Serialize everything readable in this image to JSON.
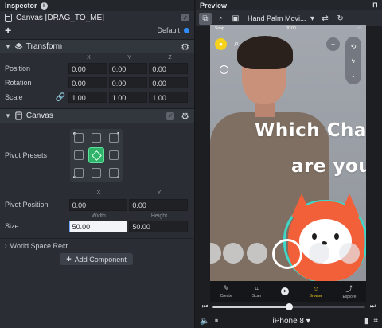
{
  "inspector": {
    "title": "Inspector",
    "info_icon": "i",
    "object_name": "Canvas [DRAG_TO_ME]",
    "object_enabled": "✓",
    "add_label": "+",
    "layer": "Default",
    "transform": {
      "title": "Transform",
      "axes": [
        "X",
        "Y",
        "Z"
      ],
      "position_label": "Position",
      "position": [
        "0.00",
        "0.00",
        "0.00"
      ],
      "rotation_label": "Rotation",
      "rotation": [
        "0.00",
        "0.00",
        "0.00"
      ],
      "scale_label": "Scale",
      "scale": [
        "1.00",
        "1.00",
        "1.00"
      ]
    },
    "canvas": {
      "title": "Canvas",
      "enabled": "✓",
      "pivot_presets_label": "Pivot Presets",
      "xy_labels": [
        "X",
        "Y"
      ],
      "pivot_position_label": "Pivot Position",
      "pivot_position": [
        "0.00",
        "0.00"
      ],
      "wh_labels": [
        "Width",
        "Height"
      ],
      "size_label": "Size",
      "size": [
        "50.00",
        "50.00"
      ],
      "world_space_label": "World Space Rect"
    },
    "add_component": "Add Component"
  },
  "preview": {
    "title": "Preview",
    "lens_name": "Hand Palm Movi...",
    "overlay_line1": "Which Cha",
    "overlay_line2": "are you",
    "status_left": "Snap",
    "status_time": "00:00",
    "nav": [
      {
        "label": "Create",
        "icon": "✎"
      },
      {
        "label": "Scan",
        "icon": "⌗"
      },
      {
        "label": "",
        "icon": "×"
      },
      {
        "label": "Browse",
        "icon": "☺"
      },
      {
        "label": "Explore",
        "icon": "⤴"
      }
    ],
    "scrub_progress": 0.5,
    "device": "iPhone 8 ▾"
  },
  "colors": {
    "accent_blue": "#2f8cff",
    "pivot_selected": "#2fb36a",
    "snap_yellow": "#f7d21c",
    "fox_orange": "#f2603a"
  }
}
